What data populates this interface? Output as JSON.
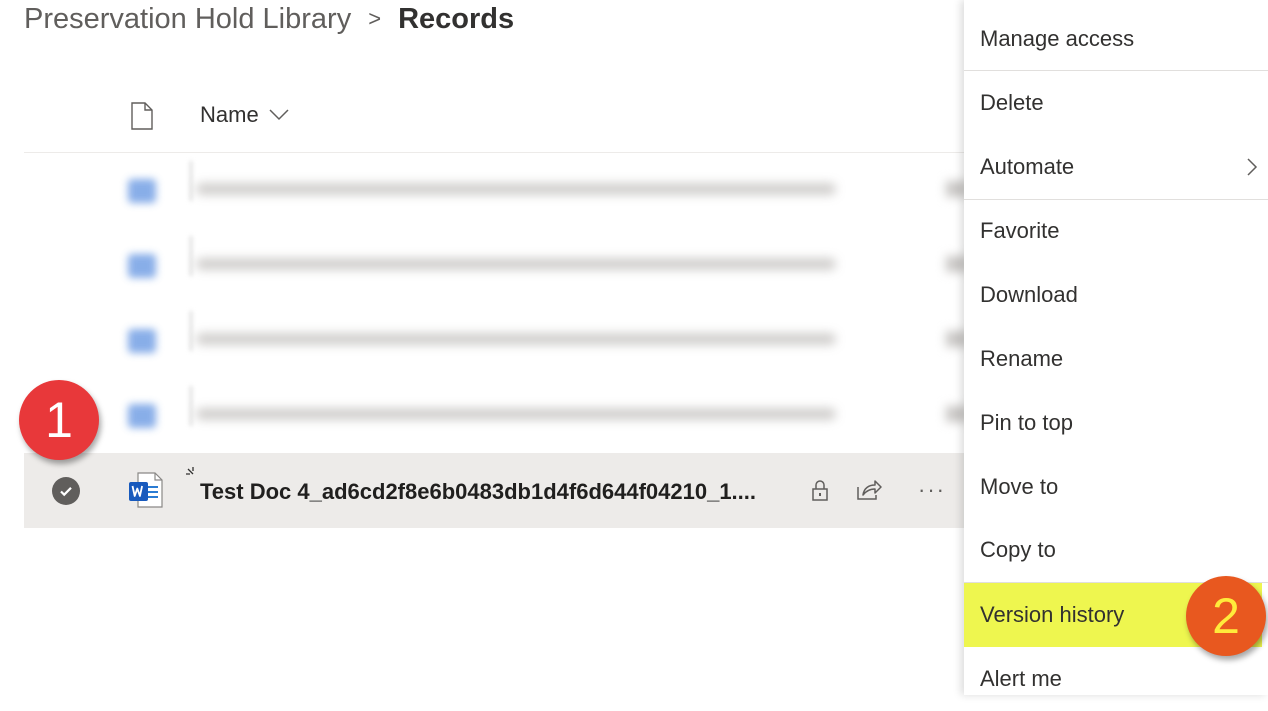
{
  "breadcrumb": {
    "parent": "Preservation Hold Library",
    "separator": ">",
    "current": "Records"
  },
  "list": {
    "columns": {
      "name": "Name"
    },
    "selected_file": {
      "name": "Test Doc 4_ad6cd2f8e6b0483db1d4f6d644f04210_1....",
      "icon": "word-doc-icon"
    },
    "more_label": "···"
  },
  "context_menu": {
    "items": [
      {
        "label": "Manage access"
      },
      {
        "label": "Delete"
      },
      {
        "label": "Automate",
        "has_submenu": true
      },
      {
        "label": "Favorite"
      },
      {
        "label": "Download"
      },
      {
        "label": "Rename"
      },
      {
        "label": "Pin to top"
      },
      {
        "label": "Move to"
      },
      {
        "label": "Copy to"
      },
      {
        "label": "Version history",
        "highlighted": true
      },
      {
        "label": "Alert me"
      }
    ]
  },
  "annotations": {
    "step1": "1",
    "step2": "2"
  },
  "colors": {
    "highlight": "#eef64f",
    "badge": "#e8383a",
    "word_blue": "#185abd"
  }
}
